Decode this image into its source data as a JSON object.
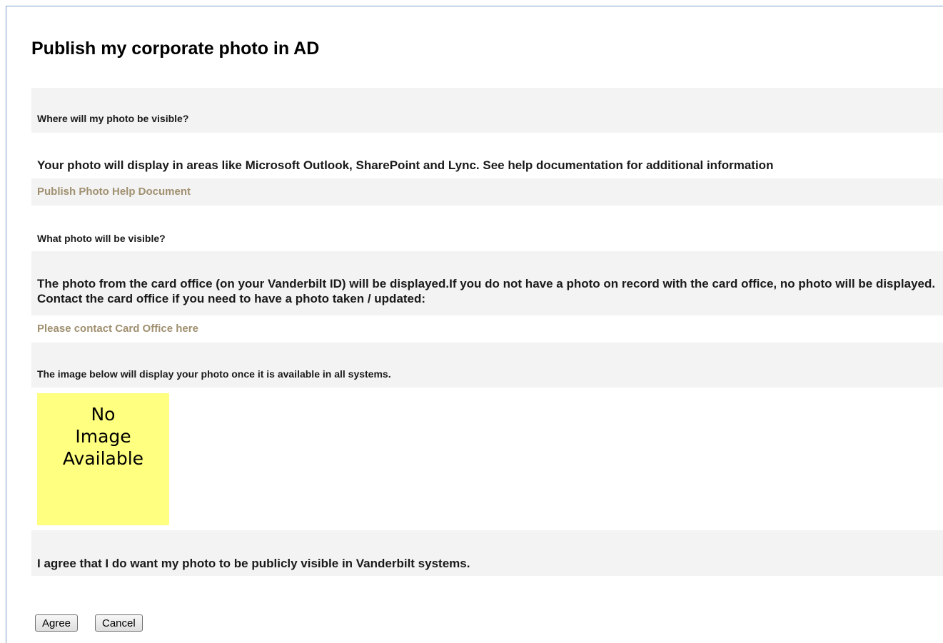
{
  "page": {
    "title": "Publish my corporate photo in AD"
  },
  "sections": {
    "where_heading": "Where will my photo be visible?",
    "where_text": "Your photo will display in areas like Microsoft Outlook, SharePoint and Lync. See help documentation for additional information",
    "help_link": "Publish Photo Help Document",
    "what_heading": "What photo will be visible?",
    "what_text": "The photo from the card office (on your Vanderbilt ID) will be displayed.If you do not have a photo on record with the card office, no photo will be displayed. Contact the card office if you need to have a photo taken / updated:",
    "card_office_link": "Please contact Card Office here",
    "image_note": "The image below will display your photo once it is available in all systems.",
    "no_image_text": "No\nImage\nAvailable",
    "agree_text": "I agree that I do want my photo to be publicly visible in Vanderbilt systems."
  },
  "buttons": {
    "agree": "Agree",
    "cancel": "Cancel"
  },
  "colors": {
    "link": "#a09070",
    "band": "#f3f3f3",
    "placeholder": "#ffff80"
  }
}
